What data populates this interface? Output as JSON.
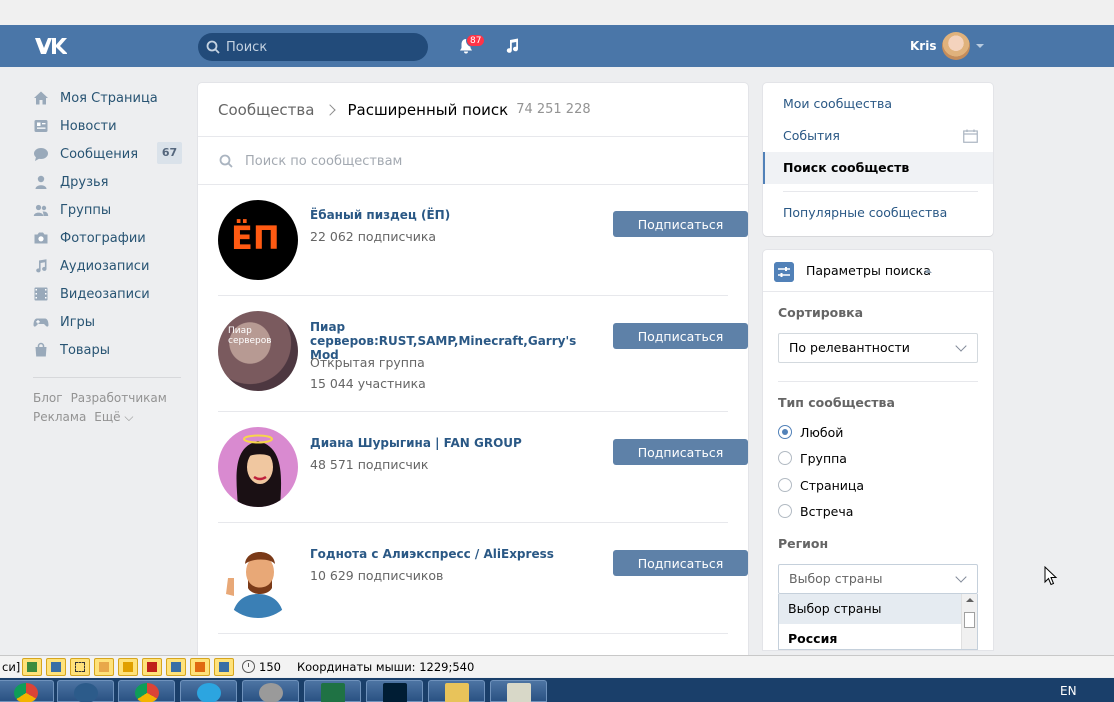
{
  "header": {
    "search_placeholder": "Поиск",
    "notifications_count": "87",
    "user_name": "Kris"
  },
  "sidebar": {
    "items": [
      {
        "label": "Моя Страница",
        "icon": "home-icon"
      },
      {
        "label": "Новости",
        "icon": "news-icon"
      },
      {
        "label": "Сообщения",
        "icon": "messages-icon",
        "badge": "67"
      },
      {
        "label": "Друзья",
        "icon": "friends-icon"
      },
      {
        "label": "Группы",
        "icon": "groups-icon"
      },
      {
        "label": "Фотографии",
        "icon": "camera-icon"
      },
      {
        "label": "Аудиозаписи",
        "icon": "music-icon"
      },
      {
        "label": "Видеозаписи",
        "icon": "video-icon"
      },
      {
        "label": "Игры",
        "icon": "gamepad-icon"
      },
      {
        "label": "Товары",
        "icon": "bag-icon"
      }
    ],
    "footer": [
      "Блог",
      "Разработчикам",
      "Реклама",
      "Ещё ⌵"
    ]
  },
  "main": {
    "breadcrumb_root": "Сообщества",
    "breadcrumb_current": "Расширенный поиск",
    "result_count": "74 251 228",
    "search_placeholder": "Поиск по сообществам",
    "subscribe_label": "Подписаться",
    "groups": [
      {
        "name": "Ёбаный пиздец (ЁП)",
        "lines": [
          "22 062 подписчика"
        ],
        "avatar_text": "ЁП"
      },
      {
        "name": "Пиар серверов:RUST,SAMP,Minecraft,Garry's Mod",
        "lines": [
          "Открытая группа",
          "15 044 участника"
        ],
        "avatar_text": "Пиар серверов"
      },
      {
        "name": "Диана Шурыгина | FAN GROUP",
        "lines": [
          "48 571 подписчик"
        ]
      },
      {
        "name": "Годнота с Алиэкспресс / AliExpress",
        "lines": [
          "10 629 подписчиков"
        ]
      }
    ]
  },
  "right_menu": {
    "items": [
      "Мои сообщества",
      "События",
      "Поиск сообществ",
      "Популярные сообщества"
    ],
    "active_index": 2
  },
  "params": {
    "title": "Параметры поиска",
    "sort_label": "Сортировка",
    "sort_value": "По релевантности",
    "type_label": "Тип сообщества",
    "type_options": [
      "Любой",
      "Группа",
      "Страница",
      "Встреча"
    ],
    "type_selected": 0,
    "region_label": "Регион",
    "region_value": "Выбор страны",
    "region_options": [
      "Выбор страны",
      "Россия"
    ]
  },
  "toolbar": {
    "left_fragment": "си]",
    "clock_value": "150",
    "mouse_coords": "Координаты мыши: 1229;540"
  },
  "taskbar": {
    "language": "EN"
  },
  "colors": {
    "header": "#4a76a8",
    "link": "#2a5885",
    "button": "#5e81a8",
    "accent": "#5181b8"
  }
}
